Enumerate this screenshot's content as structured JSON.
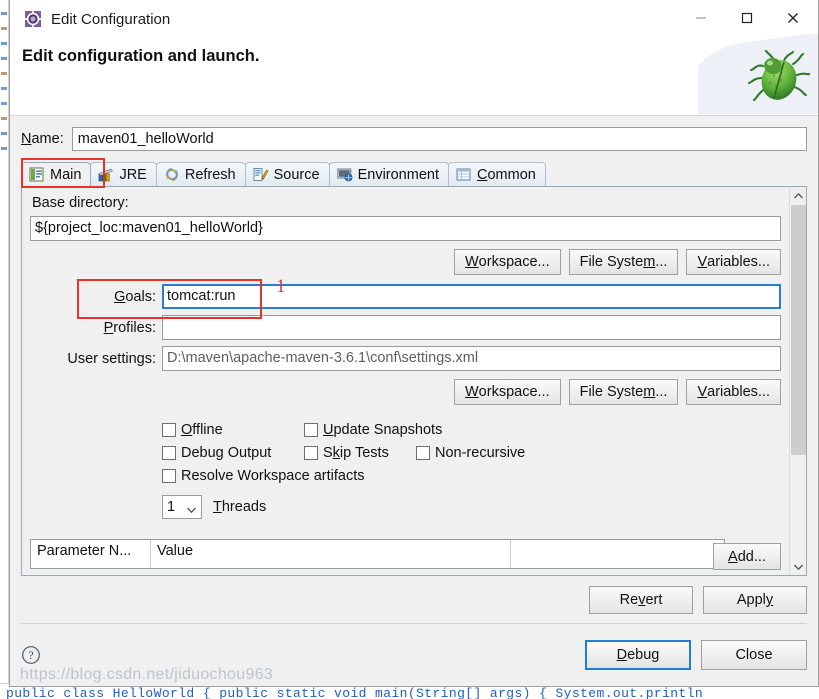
{
  "window": {
    "title": "Edit Configuration",
    "title_icon": "configuration-gear-icon",
    "minimize_label": "—",
    "maximize_label": "□",
    "close_label": "✕"
  },
  "header": {
    "title": "Edit configuration and launch.",
    "decoration_icon": "green-bug-icon"
  },
  "name_field": {
    "label": "Name:",
    "mnemonic": "N",
    "value": "maven01_helloWorld"
  },
  "tabs": [
    {
      "label": "Main",
      "icon": "main-document-icon",
      "active": true,
      "mnemonic": ""
    },
    {
      "label": "JRE",
      "icon": "jre-books-icon",
      "active": false,
      "mnemonic": ""
    },
    {
      "label": "Refresh",
      "icon": "refresh-arrows-icon",
      "active": false,
      "mnemonic": ""
    },
    {
      "label": "Source",
      "icon": "source-edit-icon",
      "active": false,
      "mnemonic": ""
    },
    {
      "label": "Environment",
      "icon": "environment-icon",
      "active": false,
      "mnemonic": ""
    },
    {
      "label": "Common",
      "icon": "common-table-icon",
      "active": false,
      "mnemonic": "C"
    }
  ],
  "main_tab": {
    "base_directory": {
      "label": "Base directory:",
      "value": "${project_loc:maven01_helloWorld}"
    },
    "browse_buttons_top": [
      {
        "label": "Workspace...",
        "mnemonic": "W"
      },
      {
        "label": "File System...",
        "mnemonic": "m"
      },
      {
        "label": "Variables...",
        "mnemonic": "V"
      }
    ],
    "goals": {
      "label": "Goals:",
      "mnemonic": "G",
      "value": "tomcat:run",
      "focused": true
    },
    "profiles": {
      "label": "Profiles:",
      "mnemonic": "P",
      "value": ""
    },
    "user_settings": {
      "label": "User settings:",
      "value": "D:\\maven\\apache-maven-3.6.1\\conf\\settings.xml"
    },
    "browse_buttons_bottom": [
      {
        "label": "Workspace...",
        "mnemonic": "W"
      },
      {
        "label": "File System...",
        "mnemonic": "m"
      },
      {
        "label": "Variables...",
        "mnemonic": "V"
      }
    ],
    "checkboxes": [
      {
        "label": "Offline",
        "checked": false,
        "mnemonic": "O"
      },
      {
        "label": "Update Snapshots",
        "checked": false,
        "mnemonic": "U"
      },
      {
        "label": "Debug Output",
        "checked": false,
        "mnemonic": "g"
      },
      {
        "label": "Skip Tests",
        "checked": false,
        "mnemonic": "k"
      },
      {
        "label": "Non-recursive",
        "checked": false,
        "mnemonic": ""
      },
      {
        "label": "Resolve Workspace artifacts",
        "checked": false,
        "mnemonic": ""
      }
    ],
    "threads": {
      "value": "1",
      "label": "Threads",
      "mnemonic": "T"
    },
    "parameters_table": {
      "columns": [
        "Parameter N...",
        "Value"
      ],
      "rows": [],
      "add_button": {
        "label": "Add...",
        "mnemonic": "A"
      }
    }
  },
  "apply_row": [
    {
      "label": "Revert",
      "mnemonic": "v"
    },
    {
      "label": "Apply",
      "mnemonic": "y"
    }
  ],
  "footer": {
    "help_icon": "help-question-icon",
    "buttons": [
      {
        "label": "Debug",
        "mnemonic": "D",
        "default": true
      },
      {
        "label": "Close",
        "mnemonic": "",
        "default": false
      }
    ]
  },
  "annotations": {
    "goal_marker": "1",
    "goal_marker_color": "#e8332a",
    "tab_highlight_color": "#e8332a"
  },
  "watermark": {
    "text": "https://blog.csdn.net/jiduochou963"
  },
  "background": {
    "bottom_code_text": "public class HelloWorld { public static void main(String[] args) { System.out.println"
  },
  "colors": {
    "dialog_bg": "#f0f0f0",
    "accent_blue": "#2a7bd6",
    "annotation_red": "#e8332a"
  }
}
